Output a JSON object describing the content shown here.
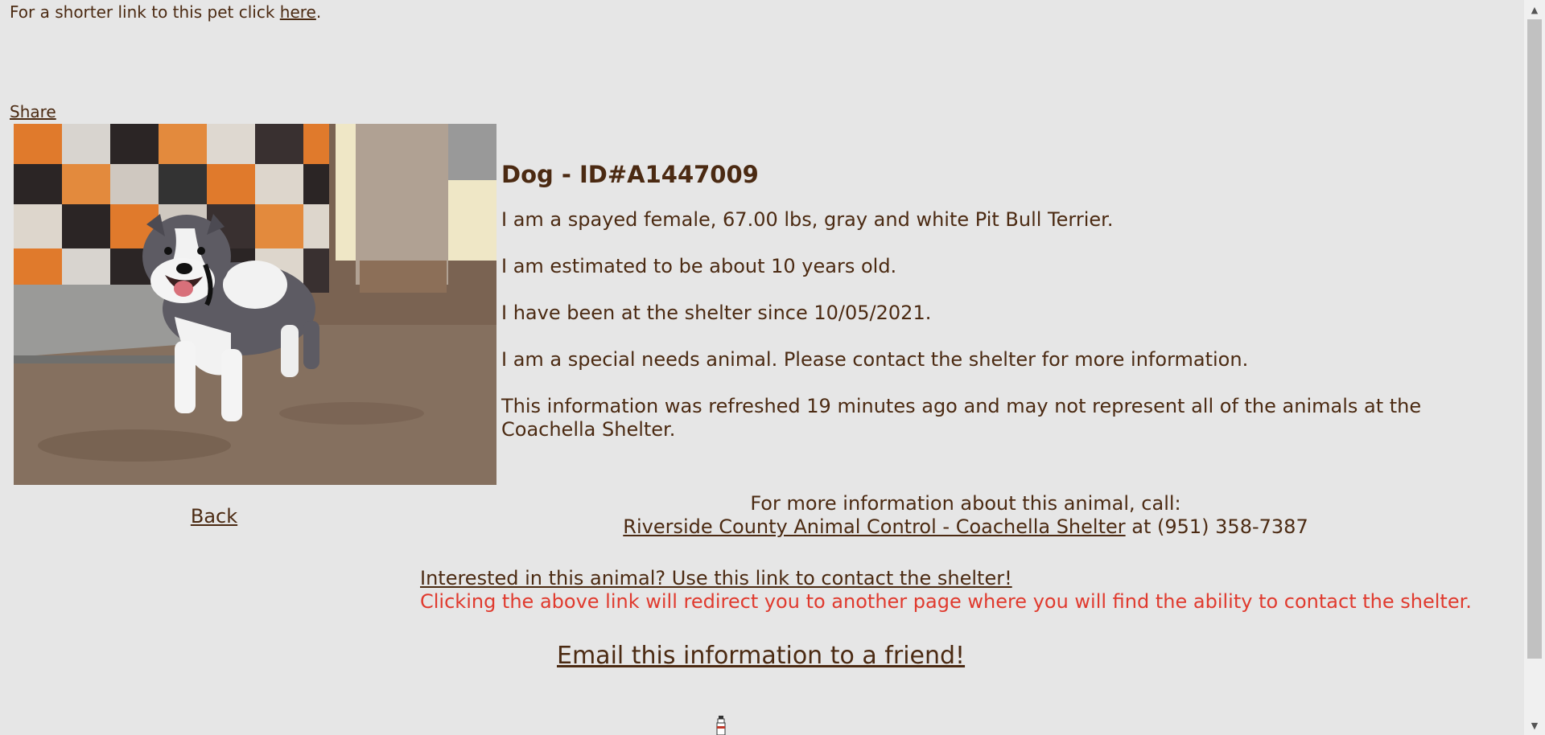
{
  "header": {
    "shorter_link_prefix": "For a shorter link to this pet click ",
    "shorter_link_text": "here",
    "shorter_link_suffix": "."
  },
  "share": {
    "label": "Share"
  },
  "photo": {
    "alt": "Photo of dog A1447009"
  },
  "back": {
    "label": "Back"
  },
  "animal": {
    "title": "Dog - ID#A1447009",
    "description": "I am a spayed female, 67.00 lbs, gray and white Pit Bull Terrier.",
    "age": "I am estimated to be about 10 years old.",
    "since": "I have been at the shelter since 10/05/2021.",
    "special_needs": "I am a special needs animal. Please contact the shelter for more information.",
    "refresh_note": "This information was refreshed 19 minutes ago and may not represent all of the animals at the Coachella Shelter."
  },
  "contact": {
    "intro": "For more information about this animal, call:",
    "shelter_name": "Riverside County Animal Control - Coachella Shelter",
    "phone_text": " at (951) 358-7387"
  },
  "interest": {
    "link_text": "Interested in this animal? Use this link to contact the shelter!",
    "redirect_note": "Clicking the above link will redirect you to another page where you will find the ability to contact the shelter."
  },
  "email": {
    "label": "Email this information to a friend!"
  },
  "colors": {
    "background": "#e6e6e6",
    "text": "#4b2a12",
    "warning": "#e03a2e"
  }
}
